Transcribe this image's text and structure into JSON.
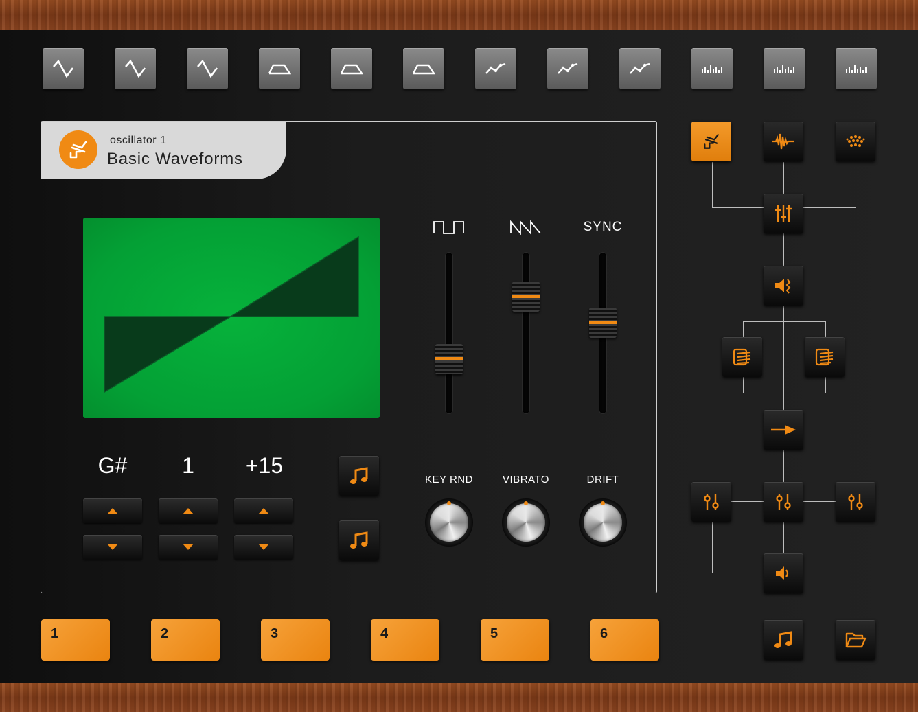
{
  "presets": [
    {
      "icon": "triangle-wave-icon"
    },
    {
      "icon": "triangle-wave-icon"
    },
    {
      "icon": "triangle-wave-icon"
    },
    {
      "icon": "envelope-icon"
    },
    {
      "icon": "envelope-icon"
    },
    {
      "icon": "envelope-icon"
    },
    {
      "icon": "lfo-icon"
    },
    {
      "icon": "lfo-icon"
    },
    {
      "icon": "lfo-icon"
    },
    {
      "icon": "spectrum-icon"
    },
    {
      "icon": "spectrum-icon"
    },
    {
      "icon": "spectrum-icon"
    }
  ],
  "oscillator": {
    "subtitle": "oscillator 1",
    "title": "Basic Waveforms"
  },
  "tuning": {
    "note": "G#",
    "octave": "1",
    "cents": "+15"
  },
  "faders": [
    {
      "label": "",
      "icon": "square-wave-icon",
      "level": 0.3
    },
    {
      "label": "",
      "icon": "saw-wave-icon",
      "level": 0.78
    },
    {
      "label": "SYNC",
      "icon": "",
      "level": 0.58
    }
  ],
  "knobs": [
    {
      "label": "KEY RND"
    },
    {
      "label": "VIBRATO"
    },
    {
      "label": "DRIFT"
    }
  ],
  "patches": [
    "1",
    "2",
    "3",
    "4",
    "5",
    "6"
  ],
  "colors": {
    "accent": "#f08a14",
    "display": "#06b23b",
    "wood": "#8d4520"
  }
}
